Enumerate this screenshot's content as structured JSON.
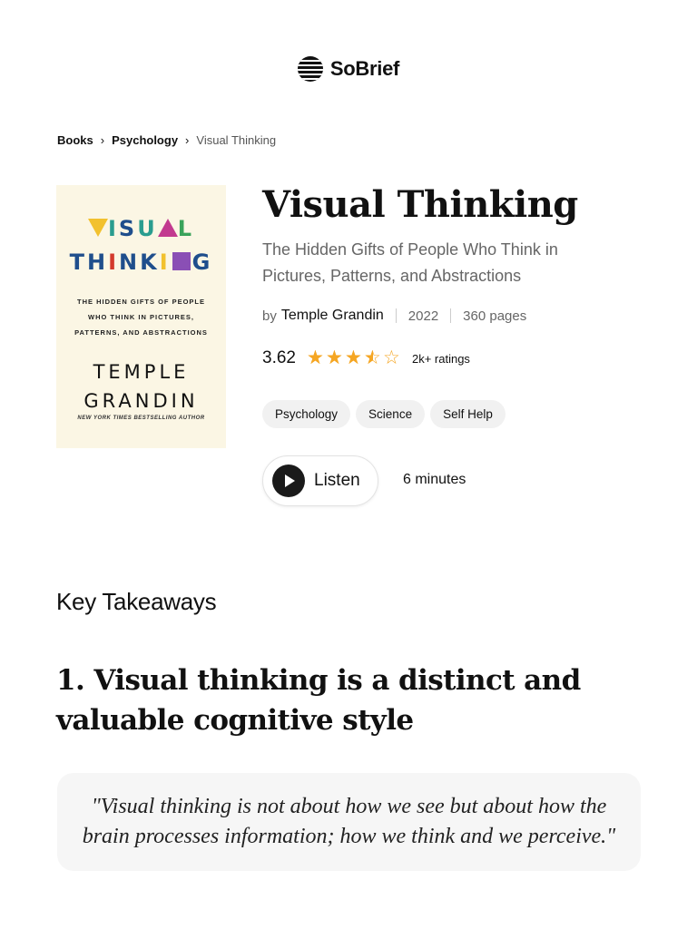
{
  "brand": {
    "name": "SoBrief"
  },
  "breadcrumb": [
    {
      "label": "Books"
    },
    {
      "label": "Psychology"
    },
    {
      "label": "Visual Thinking"
    }
  ],
  "cover": {
    "line1": [
      "V",
      "I",
      "S",
      "U",
      "A",
      "L"
    ],
    "line2": [
      "T",
      "H",
      "I",
      "N",
      "K",
      "I",
      "N",
      "G"
    ],
    "subtitle": "THE HIDDEN GIFTS OF PEOPLE WHO THINK IN PICTURES, PATTERNS, AND ABSTRACTIONS",
    "author_first": "TEMPLE",
    "author_last": "GRANDIN",
    "tagline": "NEW YORK TIMES BESTSELLING AUTHOR"
  },
  "book": {
    "title": "Visual Thinking",
    "subtitle": "The Hidden Gifts of People Who Think in Pictures, Patterns, and Abstractions",
    "by_label": "by",
    "author": "Temple Grandin",
    "year": "2022",
    "pages": "360 pages",
    "rating": "3.62",
    "rating_value": 3.62,
    "rating_max": 5,
    "ratings_count": "2k+ ratings",
    "tags": [
      "Psychology",
      "Science",
      "Self Help"
    ]
  },
  "audio": {
    "listen_label": "Listen",
    "duration": "6 minutes"
  },
  "takeaways": {
    "heading": "Key Takeaways",
    "items": [
      {
        "title": "1. Visual thinking is a distinct and valuable cognitive style",
        "quote": "\"Visual thinking is not about how we see but about how the brain processes information; how we think and we perceive.\""
      }
    ]
  },
  "colors": {
    "star": "#f5a623",
    "cover_bg": "#fbf6e4",
    "tag_bg": "#f1f1f1",
    "quote_bg": "#f6f6f6"
  }
}
